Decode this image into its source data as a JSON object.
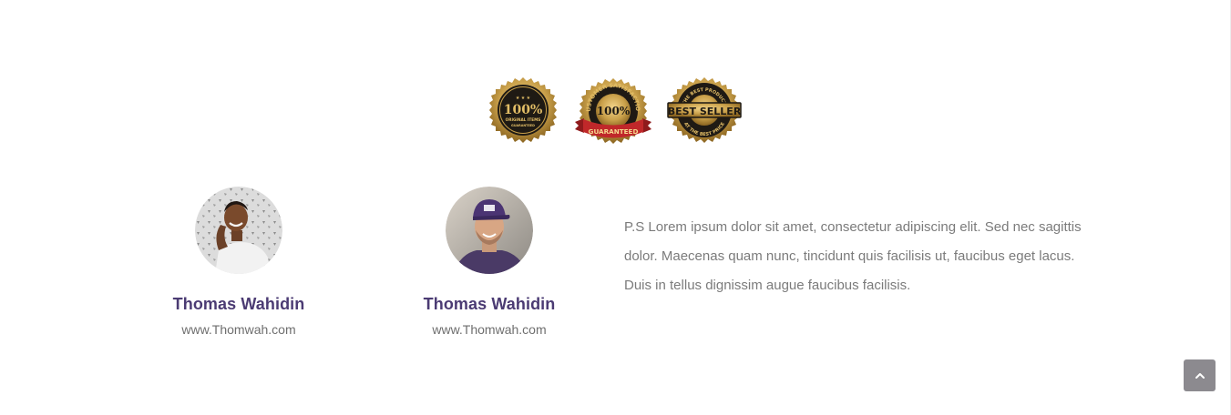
{
  "badges": [
    {
      "name": "100% original items badge",
      "big": "100%",
      "line1": "ORIGINAL ITEMS",
      "line2": "GUARANTEED"
    },
    {
      "name": "customer satisfaction guaranteed badge",
      "arc": "CUSTOMER SATISFACTION",
      "big": "100%",
      "ribbon": "GUARANTEED"
    },
    {
      "name": "best seller badge",
      "arc_top": "THE BEST PRODUCT",
      "big": "BEST SELLER",
      "arc_bottom": "AT THE BEST PRICE"
    }
  ],
  "profiles": [
    {
      "name": "Thomas Wahidin",
      "url": "www.Thomwah.com"
    },
    {
      "name": "Thomas Wahidin",
      "url": "www.Thomwah.com"
    }
  ],
  "note": "P.S Lorem ipsum dolor sit amet, consectetur adipiscing elit. Sed nec sagittis dolor. Maecenas quam nunc, tincidunt quis facilisis ut, faucibus eget lacus. Duis in tellus dignissim augue faucibus facilisis.",
  "back_to_top": {
    "icon": "chevron-up-icon"
  },
  "colors": {
    "name": "#4b3b73",
    "text": "#7b7b7b",
    "url": "#6e6e6e",
    "gold": "#c9a04a",
    "badge_dark": "#1f1a14",
    "ribbon_red": "#c0282a",
    "button": "#8c8a8f"
  }
}
